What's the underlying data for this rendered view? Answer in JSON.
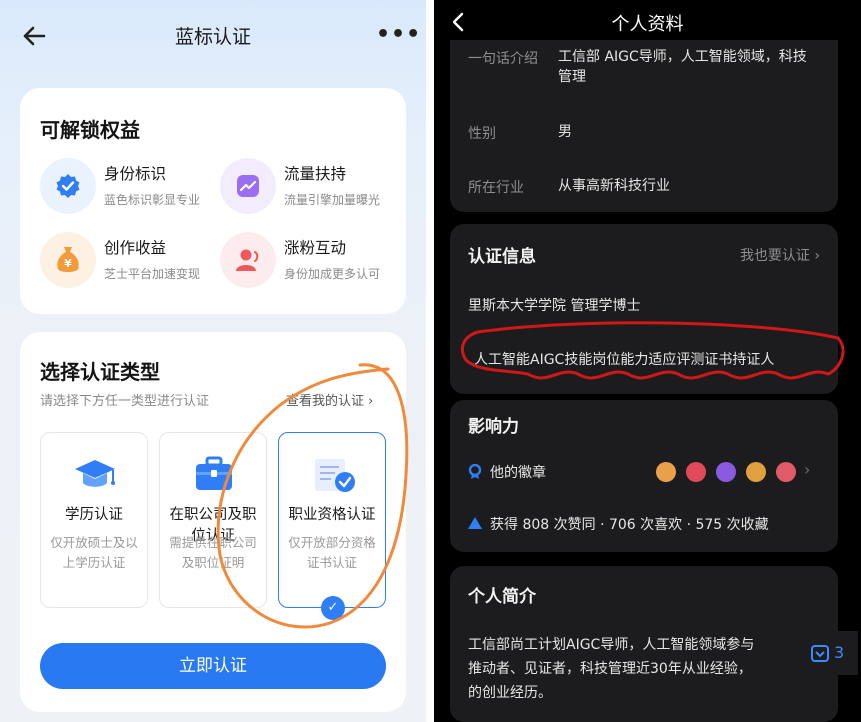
{
  "left": {
    "title": "蓝标认证",
    "more": "•••",
    "benefits_title": "可解锁权益",
    "benefits": [
      {
        "name": "身份标识",
        "desc": "蓝色标识彰显专业",
        "icon": "verified-badge-icon",
        "color": "#2f7ef5"
      },
      {
        "name": "流量扶持",
        "desc": "流量引擎加量曝光",
        "icon": "trend-chart-icon",
        "color": "#9b6df0"
      },
      {
        "name": "创作收益",
        "desc": "芝士平台加速变现",
        "icon": "money-bag-icon",
        "color": "#f39a3a"
      },
      {
        "name": "涨粉互动",
        "desc": "身份加成更多认可",
        "icon": "user-fans-icon",
        "color": "#f0585b"
      }
    ],
    "choose_title": "选择认证类型",
    "choose_subtitle": "请选择下方任一类型进行认证",
    "view_my": "查看我的认证 ›",
    "options": [
      {
        "name": "学历认证",
        "desc": "仅开放硕士及以上学历认证",
        "icon": "graduation-cap-icon",
        "selected": false
      },
      {
        "name": "在职公司及职位认证",
        "desc": "需提供在职公司及职位证明",
        "icon": "briefcase-icon",
        "selected": false
      },
      {
        "name": "职业资格认证",
        "desc": "仅开放部分资格证书认证",
        "icon": "certificate-icon",
        "selected": true
      }
    ],
    "submit": "立即认证",
    "accent": "#2979f2"
  },
  "right": {
    "title": "个人资料",
    "profile": {
      "intro_key": "一句话介绍",
      "intro_val": "工信部 AIGC导师，人工智能领域，科技管理",
      "gender_key": "性别",
      "gender_val": "男",
      "industry_key": "所在行业",
      "industry_val": "从事高新科技行业"
    },
    "cert": {
      "title": "认证信息",
      "link": "我也要认证 ›",
      "line1": "里斯本大学学院 管理学博士",
      "line2": "人工智能AIGC技能岗位能力适应评测证书持证人"
    },
    "influence": {
      "title": "影响力",
      "badges_label": "他的徽章",
      "stats": "获得 808 次赞同 · 706 次喜欢 · 575 次收藏",
      "badge_colors": [
        "#e8a04a",
        "#e04a5a",
        "#8a5ae0",
        "#e0a040",
        "#e05a6a"
      ]
    },
    "bio": {
      "title": "个人简介",
      "line1": "工信部尚工计划AIGC导师，人工智能领域参与",
      "line2": "推动者、见证者，科技管理近30年从业经验，",
      "line3": "的创业经历。"
    },
    "float_count": "3"
  }
}
